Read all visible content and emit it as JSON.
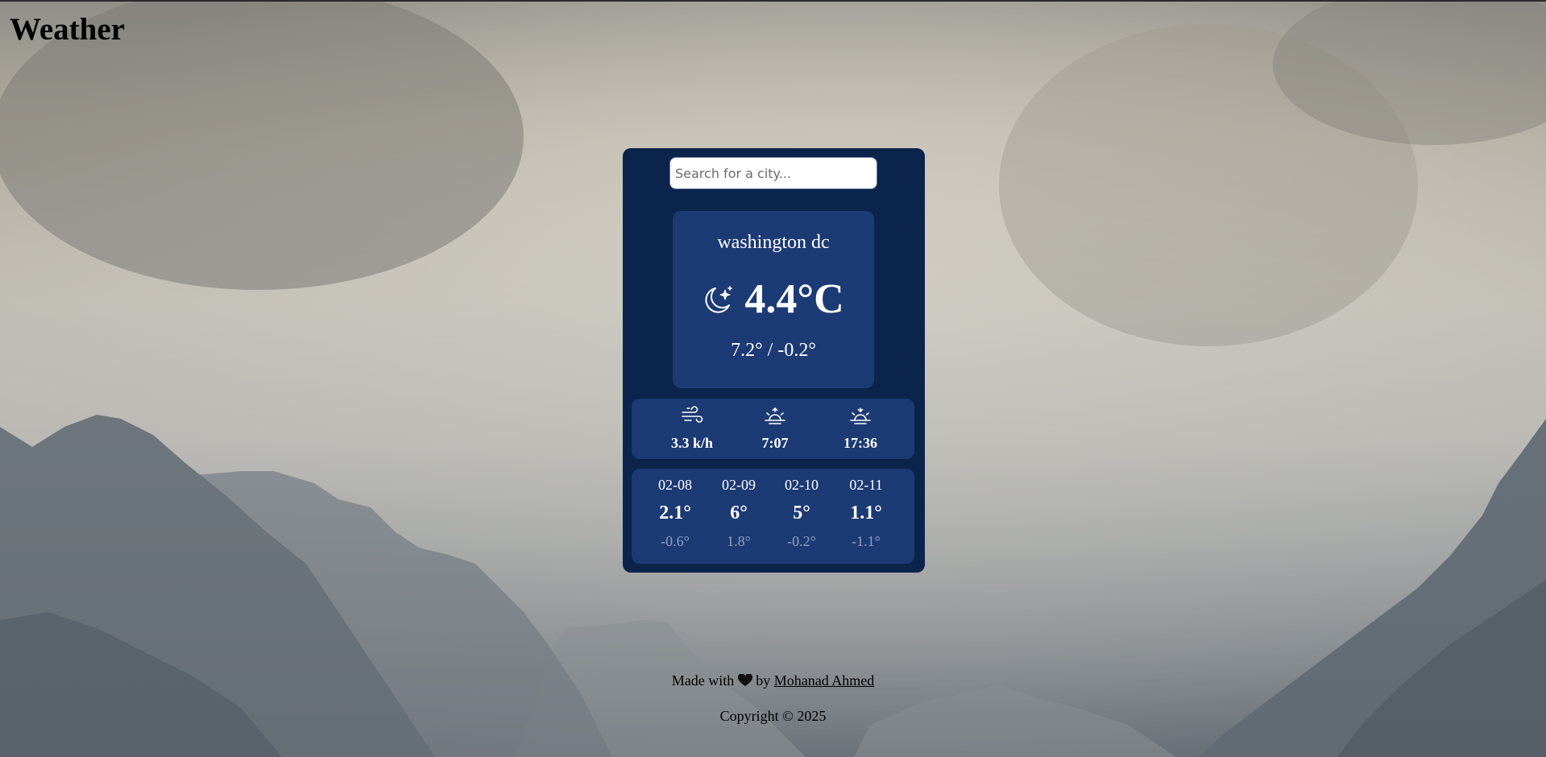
{
  "header": {
    "title": "Weather"
  },
  "search": {
    "placeholder": "Search for a city...",
    "value": ""
  },
  "current": {
    "city": "washington dc",
    "icon": "moon-stars-icon",
    "temperature": "4.4°C",
    "high_low": "7.2° / -0.2°"
  },
  "stats": [
    {
      "icon": "wind-icon",
      "value": "3.3 k/h"
    },
    {
      "icon": "sunrise-icon",
      "value": "7:07"
    },
    {
      "icon": "sunset-icon",
      "value": "17:36"
    }
  ],
  "forecast": [
    {
      "date": "02-08",
      "high": "2.1°",
      "low": "-0.6°"
    },
    {
      "date": "02-09",
      "high": "6°",
      "low": "1.8°"
    },
    {
      "date": "02-10",
      "high": "5°",
      "low": "-0.2°"
    },
    {
      "date": "02-11",
      "high": "1.1°",
      "low": "-1.1°"
    }
  ],
  "footer": {
    "made_with": "Made with",
    "heart_icon": "heart-icon",
    "by": "by",
    "author": "Mohanad Ahmed",
    "copyright": "Copyright © 2025"
  },
  "colors": {
    "card_background": "#0b244c",
    "panel_background": "#1c3a74",
    "low_temp_text": "#8fa1c4"
  }
}
